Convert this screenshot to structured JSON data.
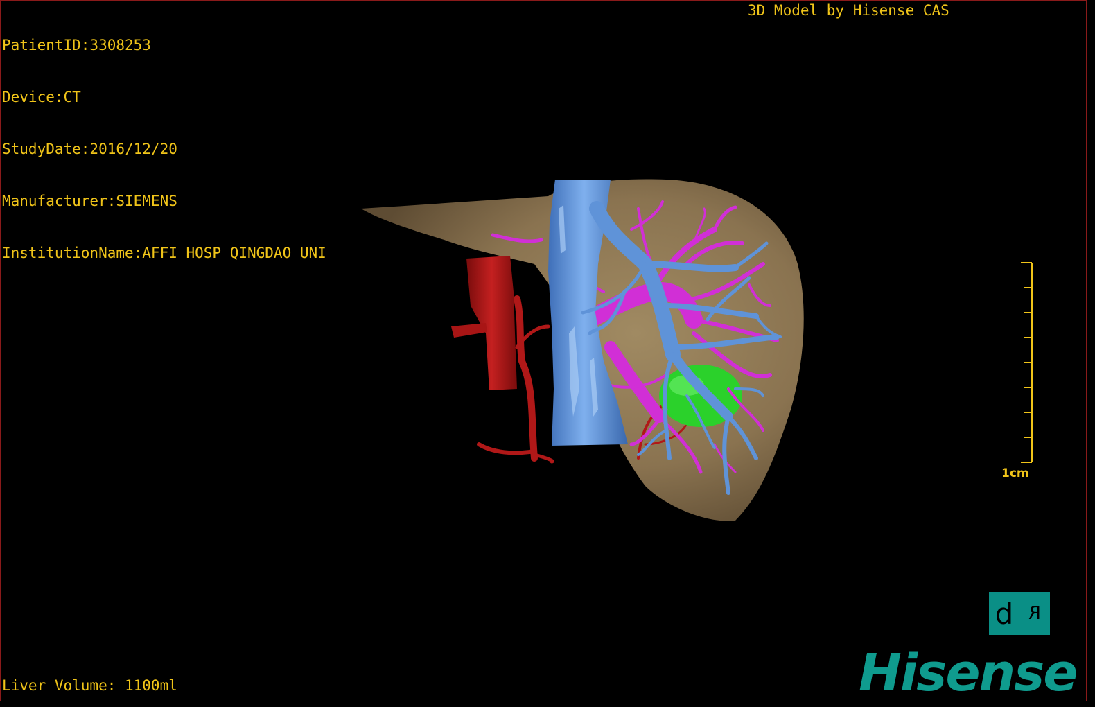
{
  "app": {
    "title": "3D Model by Hisense CAS",
    "brand": "Hisense"
  },
  "dicom": {
    "patient_id": "PatientID:3308253",
    "device": "Device:CT",
    "study_date": "StudyDate:2016/12/20",
    "manufacturer": "Manufacturer:SIEMENS",
    "institution": "InstitutionName:AFFI HOSP QINGDAO UNI"
  },
  "measurements": {
    "liver_volume": "Liver Volume: 1100ml"
  },
  "scale_bar": {
    "label": "1cm",
    "tick_count": 9
  },
  "orientation_cube": {
    "left_face": "d",
    "right_face": "R"
  },
  "colors": {
    "overlay_text": "#f0c419",
    "liver": "#8a7350",
    "vena_cava": "#5b8fd6",
    "portal_vein": "#d12fd6",
    "artery": "#b01818",
    "tumor": "#2bd12b",
    "viewport_border": "#8a1a1a",
    "brand": "#0f9b8e"
  },
  "icons": {
    "orientation_cube": "orientation-cube-icon",
    "logo": "hisense-logo"
  }
}
